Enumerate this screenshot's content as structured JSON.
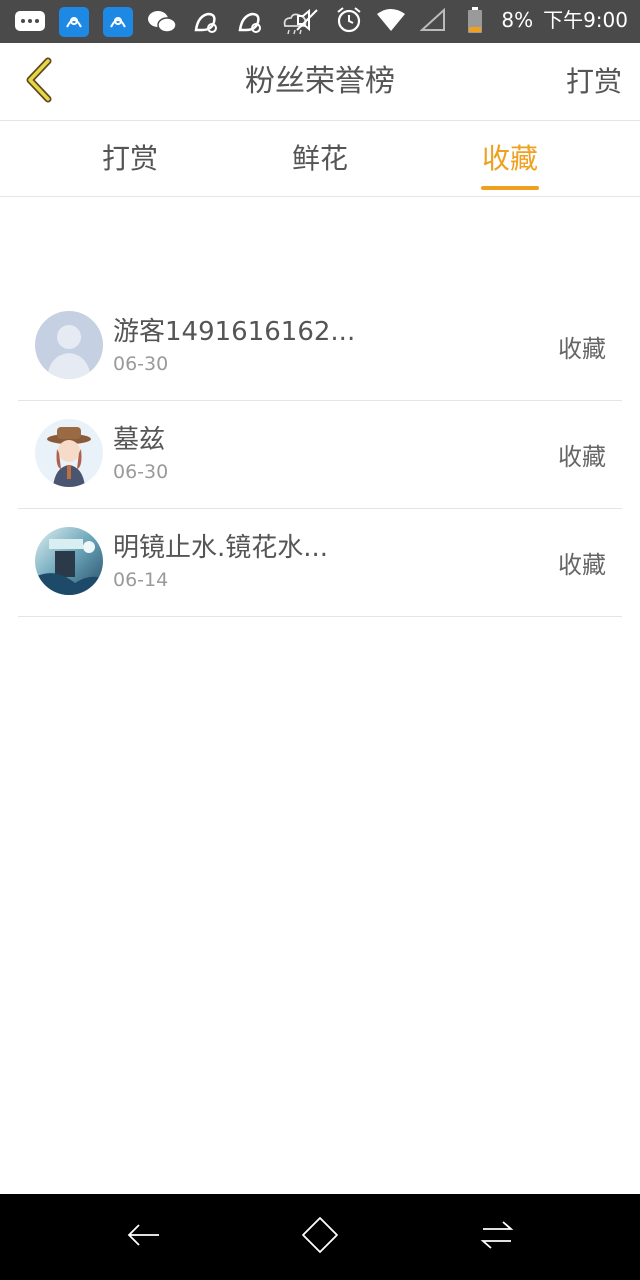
{
  "status_bar": {
    "left_icons": [
      "message-icon",
      "wifi-hotspot-icon",
      "wifi-hotspot-icon",
      "wechat-icon",
      "uc-browser-icon",
      "uc-browser-icon",
      "weather-icon"
    ],
    "right_icons": [
      "mute-icon",
      "alarm-icon",
      "wifi-icon",
      "signal-icon",
      "battery-icon"
    ],
    "battery": "8%",
    "time": "下午9:00"
  },
  "header": {
    "back_icon": "chevron-left-icon",
    "title": "粉丝荣誉榜",
    "right_action": "打赏"
  },
  "tabs": [
    {
      "label": "打赏",
      "active": false
    },
    {
      "label": "鲜花",
      "active": false
    },
    {
      "label": "收藏",
      "active": true
    }
  ],
  "accent_color": "#f0a020",
  "list": [
    {
      "name": "游客1491616162...",
      "date": "06-30",
      "action": "收藏",
      "avatar": "default-avatar"
    },
    {
      "name": "墓兹",
      "date": "06-30",
      "action": "收藏",
      "avatar": "anime-girl-avatar"
    },
    {
      "name": "明镜止水.镜花水...",
      "date": "06-14",
      "action": "收藏",
      "avatar": "scenery-avatar"
    }
  ],
  "nav_bar": {
    "back_icon": "back-arrow-icon",
    "home_icon": "home-icon",
    "recent_icon": "switch-apps-icon"
  }
}
